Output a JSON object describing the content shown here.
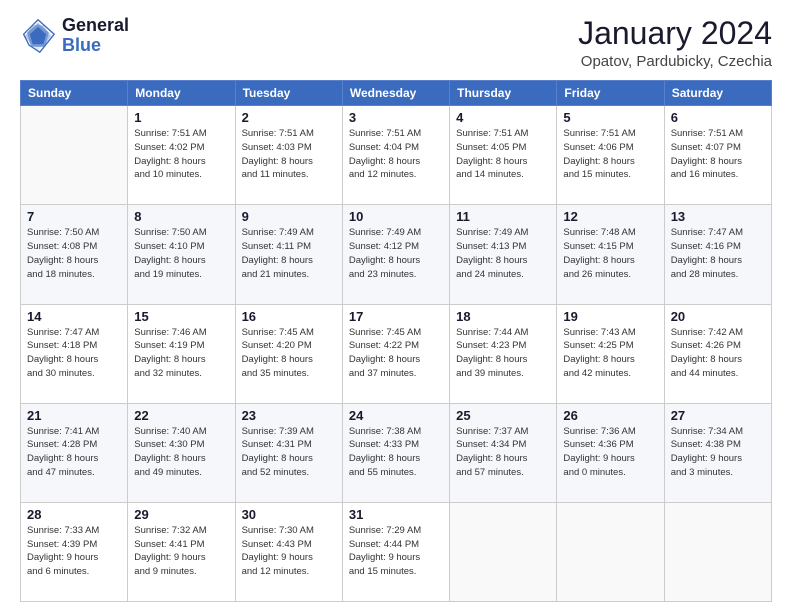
{
  "logo": {
    "line1": "General",
    "line2": "Blue"
  },
  "title": "January 2024",
  "location": "Opatov, Pardubicky, Czechia",
  "weekdays": [
    "Sunday",
    "Monday",
    "Tuesday",
    "Wednesday",
    "Thursday",
    "Friday",
    "Saturday"
  ],
  "weeks": [
    [
      {
        "day": "",
        "info": ""
      },
      {
        "day": "1",
        "info": "Sunrise: 7:51 AM\nSunset: 4:02 PM\nDaylight: 8 hours\nand 10 minutes."
      },
      {
        "day": "2",
        "info": "Sunrise: 7:51 AM\nSunset: 4:03 PM\nDaylight: 8 hours\nand 11 minutes."
      },
      {
        "day": "3",
        "info": "Sunrise: 7:51 AM\nSunset: 4:04 PM\nDaylight: 8 hours\nand 12 minutes."
      },
      {
        "day": "4",
        "info": "Sunrise: 7:51 AM\nSunset: 4:05 PM\nDaylight: 8 hours\nand 14 minutes."
      },
      {
        "day": "5",
        "info": "Sunrise: 7:51 AM\nSunset: 4:06 PM\nDaylight: 8 hours\nand 15 minutes."
      },
      {
        "day": "6",
        "info": "Sunrise: 7:51 AM\nSunset: 4:07 PM\nDaylight: 8 hours\nand 16 minutes."
      }
    ],
    [
      {
        "day": "7",
        "info": "Sunrise: 7:50 AM\nSunset: 4:08 PM\nDaylight: 8 hours\nand 18 minutes."
      },
      {
        "day": "8",
        "info": "Sunrise: 7:50 AM\nSunset: 4:10 PM\nDaylight: 8 hours\nand 19 minutes."
      },
      {
        "day": "9",
        "info": "Sunrise: 7:49 AM\nSunset: 4:11 PM\nDaylight: 8 hours\nand 21 minutes."
      },
      {
        "day": "10",
        "info": "Sunrise: 7:49 AM\nSunset: 4:12 PM\nDaylight: 8 hours\nand 23 minutes."
      },
      {
        "day": "11",
        "info": "Sunrise: 7:49 AM\nSunset: 4:13 PM\nDaylight: 8 hours\nand 24 minutes."
      },
      {
        "day": "12",
        "info": "Sunrise: 7:48 AM\nSunset: 4:15 PM\nDaylight: 8 hours\nand 26 minutes."
      },
      {
        "day": "13",
        "info": "Sunrise: 7:47 AM\nSunset: 4:16 PM\nDaylight: 8 hours\nand 28 minutes."
      }
    ],
    [
      {
        "day": "14",
        "info": "Sunrise: 7:47 AM\nSunset: 4:18 PM\nDaylight: 8 hours\nand 30 minutes."
      },
      {
        "day": "15",
        "info": "Sunrise: 7:46 AM\nSunset: 4:19 PM\nDaylight: 8 hours\nand 32 minutes."
      },
      {
        "day": "16",
        "info": "Sunrise: 7:45 AM\nSunset: 4:20 PM\nDaylight: 8 hours\nand 35 minutes."
      },
      {
        "day": "17",
        "info": "Sunrise: 7:45 AM\nSunset: 4:22 PM\nDaylight: 8 hours\nand 37 minutes."
      },
      {
        "day": "18",
        "info": "Sunrise: 7:44 AM\nSunset: 4:23 PM\nDaylight: 8 hours\nand 39 minutes."
      },
      {
        "day": "19",
        "info": "Sunrise: 7:43 AM\nSunset: 4:25 PM\nDaylight: 8 hours\nand 42 minutes."
      },
      {
        "day": "20",
        "info": "Sunrise: 7:42 AM\nSunset: 4:26 PM\nDaylight: 8 hours\nand 44 minutes."
      }
    ],
    [
      {
        "day": "21",
        "info": "Sunrise: 7:41 AM\nSunset: 4:28 PM\nDaylight: 8 hours\nand 47 minutes."
      },
      {
        "day": "22",
        "info": "Sunrise: 7:40 AM\nSunset: 4:30 PM\nDaylight: 8 hours\nand 49 minutes."
      },
      {
        "day": "23",
        "info": "Sunrise: 7:39 AM\nSunset: 4:31 PM\nDaylight: 8 hours\nand 52 minutes."
      },
      {
        "day": "24",
        "info": "Sunrise: 7:38 AM\nSunset: 4:33 PM\nDaylight: 8 hours\nand 55 minutes."
      },
      {
        "day": "25",
        "info": "Sunrise: 7:37 AM\nSunset: 4:34 PM\nDaylight: 8 hours\nand 57 minutes."
      },
      {
        "day": "26",
        "info": "Sunrise: 7:36 AM\nSunset: 4:36 PM\nDaylight: 9 hours\nand 0 minutes."
      },
      {
        "day": "27",
        "info": "Sunrise: 7:34 AM\nSunset: 4:38 PM\nDaylight: 9 hours\nand 3 minutes."
      }
    ],
    [
      {
        "day": "28",
        "info": "Sunrise: 7:33 AM\nSunset: 4:39 PM\nDaylight: 9 hours\nand 6 minutes."
      },
      {
        "day": "29",
        "info": "Sunrise: 7:32 AM\nSunset: 4:41 PM\nDaylight: 9 hours\nand 9 minutes."
      },
      {
        "day": "30",
        "info": "Sunrise: 7:30 AM\nSunset: 4:43 PM\nDaylight: 9 hours\nand 12 minutes."
      },
      {
        "day": "31",
        "info": "Sunrise: 7:29 AM\nSunset: 4:44 PM\nDaylight: 9 hours\nand 15 minutes."
      },
      {
        "day": "",
        "info": ""
      },
      {
        "day": "",
        "info": ""
      },
      {
        "day": "",
        "info": ""
      }
    ]
  ]
}
